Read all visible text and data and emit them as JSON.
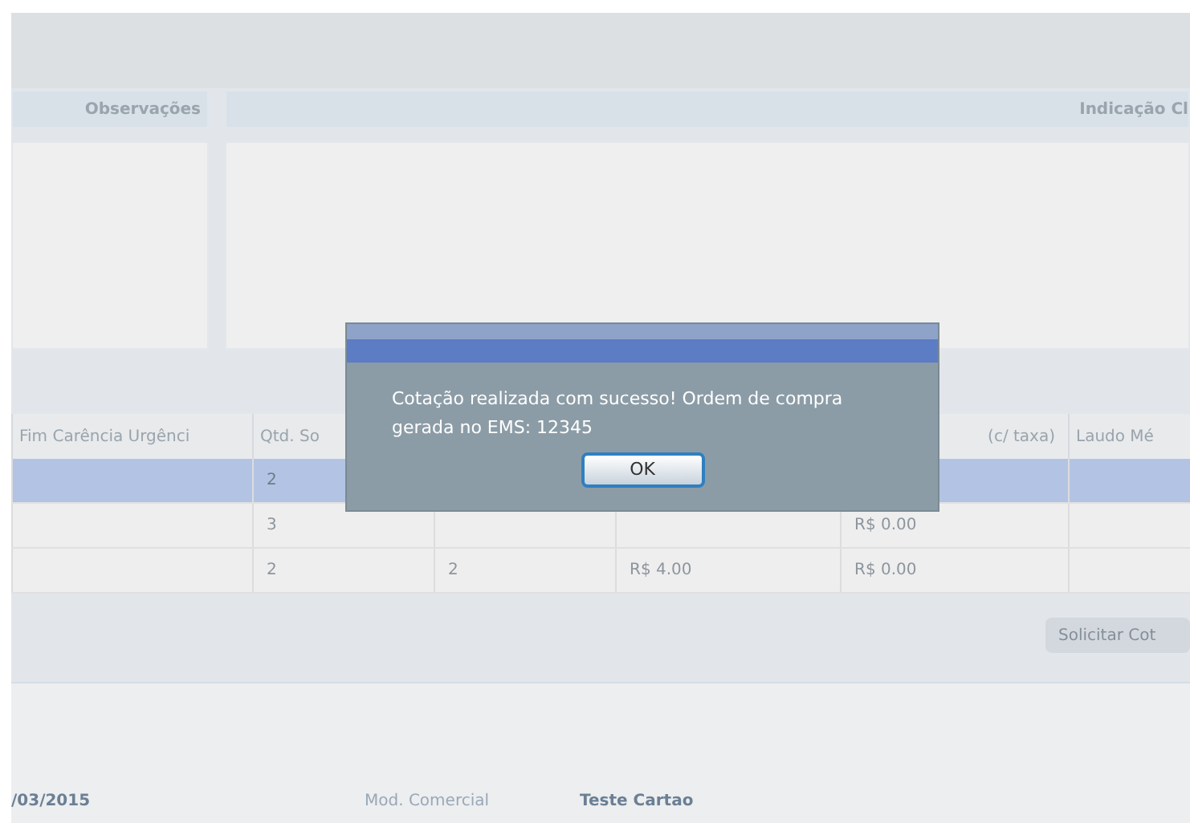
{
  "notes_header": {
    "observacoes": "Observações",
    "indicacao": "Indicação Cl"
  },
  "table": {
    "columns": [
      "Fim Carência Urgênci",
      "Qtd. So",
      "",
      "",
      "(c/ taxa)",
      "Laudo Mé"
    ],
    "rows": [
      {
        "selected": true,
        "cells": [
          "",
          "2",
          "",
          "",
          "",
          ""
        ]
      },
      {
        "selected": false,
        "cells": [
          "",
          "3",
          "",
          "",
          "R$ 0.00",
          ""
        ]
      },
      {
        "selected": false,
        "cells": [
          "",
          "2",
          "2",
          "R$ 4.00",
          "R$ 0.00",
          ""
        ]
      }
    ]
  },
  "request_button": {
    "label": "Solicitar Cot",
    "disabled": true
  },
  "footer": {
    "date": "/03/2015",
    "label": "Mod. Comercial",
    "value": "Teste Cartao"
  },
  "dialog": {
    "message": "Cotação realizada com sucesso! Ordem de compra gerada no EMS: 12345",
    "button": "OK"
  }
}
